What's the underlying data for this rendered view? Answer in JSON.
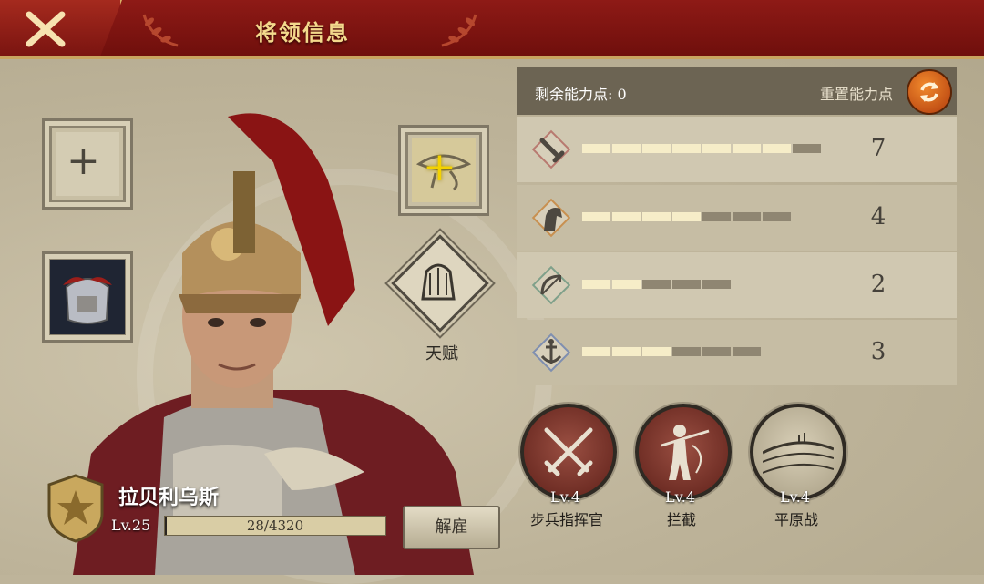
{
  "header": {
    "title": "将领信息"
  },
  "equipment": {
    "talent_label": "天赋"
  },
  "general": {
    "name": "拉贝利乌斯",
    "level": "Lv.25",
    "xp": "28/4320",
    "xp_fraction": 0.0065,
    "fire_label": "解雇"
  },
  "stats": {
    "remaining_label": "剩余能力点: 0",
    "reset_label": "重置能力点",
    "rows": [
      {
        "icon": "sword-icon",
        "value": "7",
        "filled": 7,
        "total": 8
      },
      {
        "icon": "horse-icon",
        "value": "4",
        "filled": 4,
        "total": 7
      },
      {
        "icon": "bow-icon",
        "value": "2",
        "filled": 2,
        "total": 5
      },
      {
        "icon": "anchor-icon",
        "value": "3",
        "filled": 3,
        "total": 6
      }
    ]
  },
  "skills": [
    {
      "icon": "crossed-swords-icon",
      "level": "Lv.4",
      "name": "步兵指挥官"
    },
    {
      "icon": "spearman-icon",
      "level": "Lv.4",
      "name": "拦截"
    },
    {
      "icon": "plains-icon",
      "level": "Lv.4",
      "name": "平原战"
    }
  ],
  "colors": {
    "header": "#8e1a16",
    "gold": "#f3d98c",
    "bar_on": "#f6edc8",
    "bar_off": "#8f8672"
  }
}
